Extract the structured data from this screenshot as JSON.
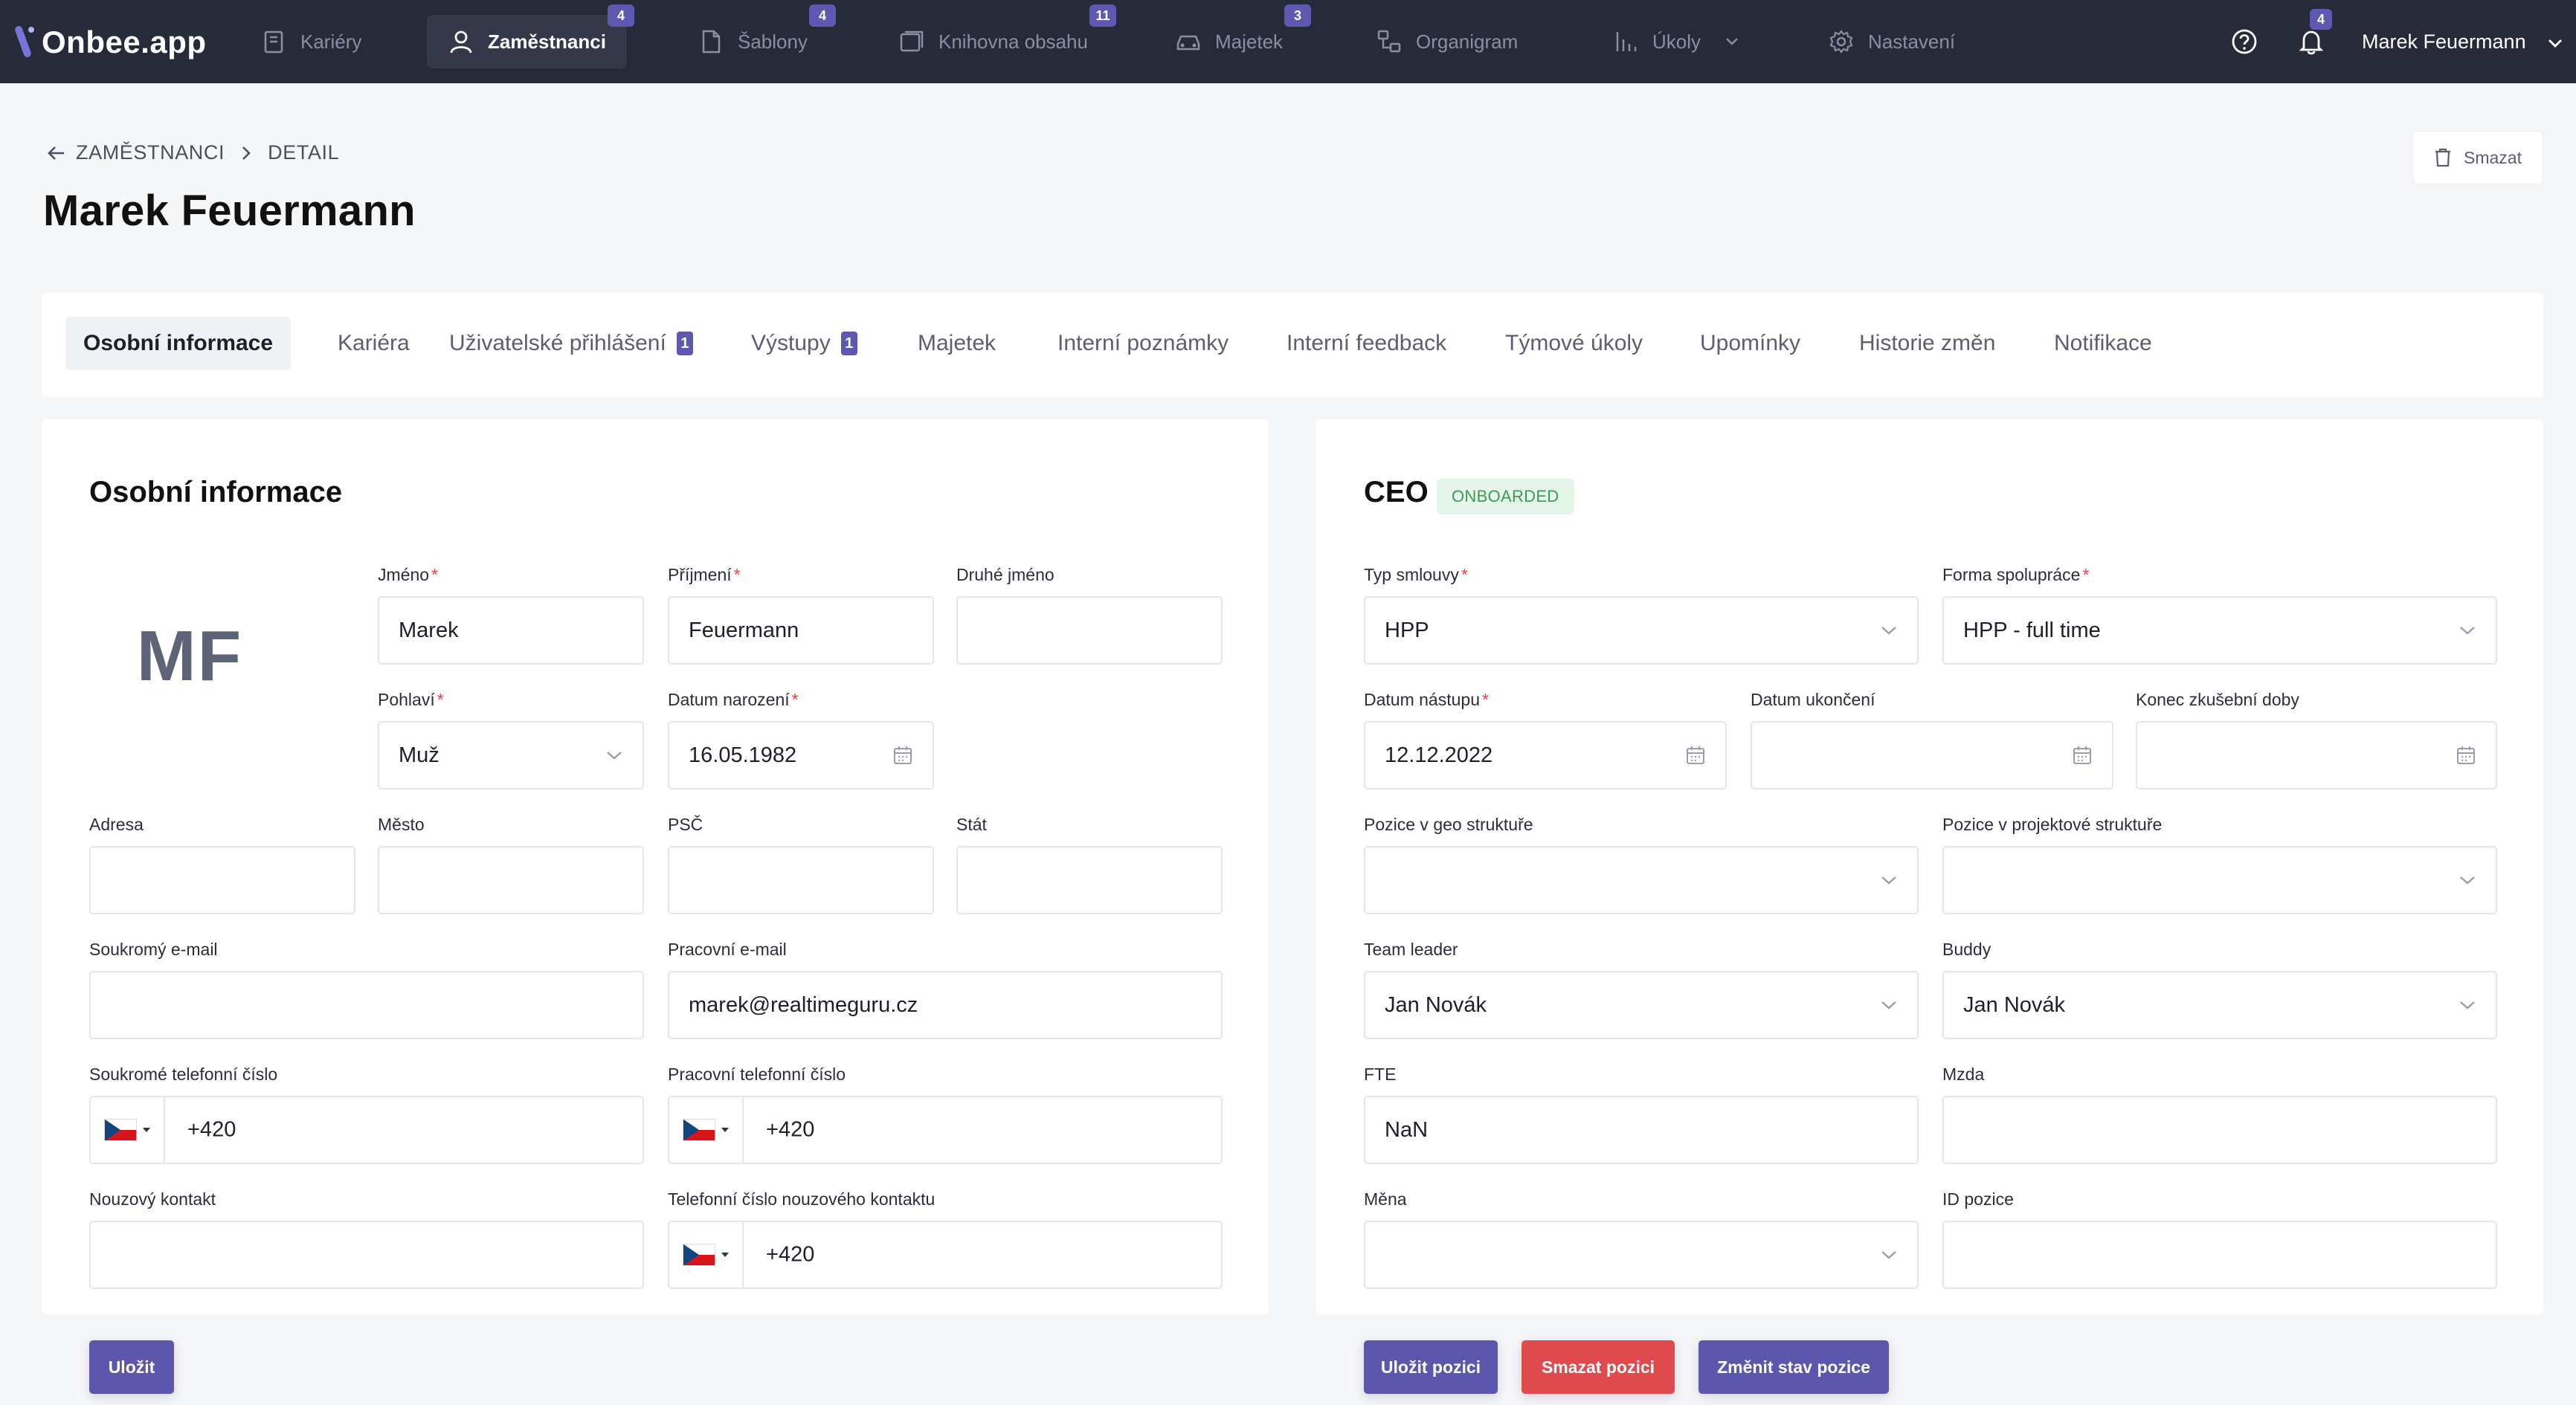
{
  "app": {
    "logo_text": "Onbee.app"
  },
  "nav": {
    "items": [
      {
        "label": "Kariéry",
        "icon": "clipboard-icon",
        "badge": ""
      },
      {
        "label": "Zaměstnanci",
        "icon": "user-icon",
        "badge": "4"
      },
      {
        "label": "Šablony",
        "icon": "document-icon",
        "badge": "4"
      },
      {
        "label": "Knihovna obsahu",
        "icon": "library-icon",
        "badge": "11"
      },
      {
        "label": "Majetek",
        "icon": "car-icon",
        "badge": "3"
      },
      {
        "label": "Organigram",
        "icon": "org-chart-icon",
        "badge": ""
      },
      {
        "label": "Úkoly",
        "icon": "bar-chart-icon",
        "badge": ""
      },
      {
        "label": "Nastavení",
        "icon": "gear-icon",
        "badge": ""
      }
    ],
    "notifications_badge": "4",
    "user_name": "Marek Feuermann"
  },
  "header": {
    "breadcrumb": [
      "ZAMĚSTNANCI",
      "DETAIL"
    ],
    "title": "Marek Feuermann",
    "delete_label": "Smazat"
  },
  "tabs": [
    {
      "label": "Osobní informace",
      "badge": ""
    },
    {
      "label": "Kariéra",
      "badge": ""
    },
    {
      "label": "Uživatelské přihlášení",
      "badge": "1"
    },
    {
      "label": "Výstupy",
      "badge": "1"
    },
    {
      "label": "Majetek",
      "badge": ""
    },
    {
      "label": "Interní poznámky",
      "badge": ""
    },
    {
      "label": "Interní feedback",
      "badge": ""
    },
    {
      "label": "Týmové úkoly",
      "badge": ""
    },
    {
      "label": "Upomínky",
      "badge": ""
    },
    {
      "label": "Historie změn",
      "badge": ""
    },
    {
      "label": "Notifikace",
      "badge": ""
    }
  ],
  "personal": {
    "title": "Osobní informace",
    "avatar_initials": "MF",
    "fields": {
      "first_name": {
        "label": "Jméno",
        "value": "Marek"
      },
      "last_name": {
        "label": "Příjmení",
        "value": "Feuermann"
      },
      "middle_name": {
        "label": "Druhé jméno",
        "value": ""
      },
      "gender": {
        "label": "Pohlaví",
        "value": "Muž"
      },
      "birth_date": {
        "label": "Datum narození",
        "value": "16.05.1982"
      },
      "address": {
        "label": "Adresa",
        "value": ""
      },
      "city": {
        "label": "Město",
        "value": ""
      },
      "zip": {
        "label": "PSČ",
        "value": ""
      },
      "country": {
        "label": "Stát",
        "value": ""
      },
      "private_email": {
        "label": "Soukromý e-mail",
        "value": ""
      },
      "work_email": {
        "label": "Pracovní e-mail",
        "value": "marek@realtimeguru.cz"
      },
      "private_phone": {
        "label": "Soukromé telefonní číslo",
        "value": "+420"
      },
      "work_phone": {
        "label": "Pracovní telefonní číslo",
        "value": "+420"
      },
      "emergency_contact": {
        "label": "Nouzový kontakt",
        "value": ""
      },
      "emergency_phone": {
        "label": "Telefonní číslo nouzového kontaktu",
        "value": "+420"
      }
    },
    "save_label": "Uložit"
  },
  "position": {
    "title": "CEO",
    "status": "ONBOARDED",
    "fields": {
      "contract_type": {
        "label": "Typ smlouvy",
        "value": "HPP"
      },
      "cooperation_form": {
        "label": "Forma spolupráce",
        "value": "HPP - full time"
      },
      "start_date": {
        "label": "Datum nástupu",
        "value": "12.12.2022"
      },
      "end_date": {
        "label": "Datum ukončení",
        "value": ""
      },
      "probation_end": {
        "label": "Konec zkušební doby",
        "value": ""
      },
      "geo_position": {
        "label": "Pozice v geo struktuře",
        "value": ""
      },
      "project_position": {
        "label": "Pozice v projektové struktuře",
        "value": ""
      },
      "team_leader": {
        "label": "Team leader",
        "value": "Jan Novák"
      },
      "buddy": {
        "label": "Buddy",
        "value": "Jan Novák"
      },
      "fte": {
        "label": "FTE",
        "value": "NaN"
      },
      "salary": {
        "label": "Mzda",
        "value": ""
      },
      "currency": {
        "label": "Měna",
        "value": ""
      },
      "position_id": {
        "label": "ID pozice",
        "value": ""
      }
    },
    "save_label": "Uložit pozici",
    "delete_label": "Smazat pozici",
    "change_status_label": "Změnit stav pozice"
  },
  "colors": {
    "nav_bg": "#262a39",
    "accent": "#5d56ad",
    "danger": "#df4a4f",
    "success_bg": "#e6f5e9",
    "success_text": "#3b9a55"
  }
}
